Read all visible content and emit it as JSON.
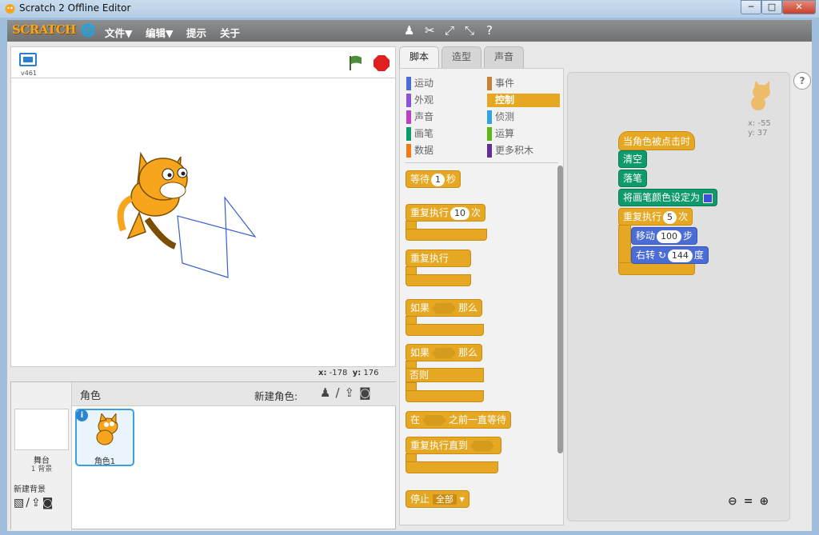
{
  "window": {
    "title": "Scratch 2 Offline Editor",
    "minimize": "─",
    "maximize": "□",
    "close": "✕"
  },
  "menu": {
    "logo": "SCRATCH",
    "file": "文件▼",
    "edit": "编辑▼",
    "tips": "提示",
    "about": "关于"
  },
  "stage": {
    "version": "v461",
    "x_label": "x:",
    "x": "-178",
    "y_label": "y:",
    "y": "176"
  },
  "sprites": {
    "title": "角色",
    "new_sprite": "新建角色:",
    "stage_label": "舞台",
    "stage_bg_count": "1 背景",
    "new_bg": "新建背景",
    "sprite1": "角色1"
  },
  "tabs": [
    "脚本",
    "造型",
    "声音"
  ],
  "categories": {
    "left": [
      "运动",
      "外观",
      "声音",
      "画笔",
      "数据"
    ],
    "right": [
      "事件",
      "控制",
      "侦测",
      "运算",
      "更多积木"
    ]
  },
  "palette": {
    "wait": "等待",
    "wait_num": "1",
    "wait_unit": "秒",
    "repeat": "重复执行",
    "repeat_num": "10",
    "repeat_unit": "次",
    "forever": "重复执行",
    "if": "如果",
    "then": "那么",
    "if2": "如果",
    "then2": "那么",
    "else": "否则",
    "wait_until_pre": "在",
    "wait_until_post": "之前一直等待",
    "repeat_until": "重复执行直到",
    "stop": "停止",
    "stop_opt": "全部"
  },
  "script": {
    "hat": "当角色被点击时",
    "clear": "清空",
    "pendown": "落笔",
    "setcolor": "将画笔颜色设定为",
    "repeat": "重复执行",
    "repeat_num": "5",
    "repeat_unit": "次",
    "move": "移动",
    "move_num": "100",
    "move_unit": "步",
    "turn": "右转",
    "turn_num": "144",
    "turn_unit": "度",
    "sprite_x": "x: -55",
    "sprite_y": "y: 37"
  },
  "colors": {
    "control": "#e6a822",
    "pen": "#0e9a6c",
    "motion": "#4a6cd4",
    "pen_color": "#3a4fd6"
  },
  "icons": [
    "globe-icon",
    "stamp-icon",
    "cut-icon",
    "grow-icon",
    "shrink-icon",
    "help-icon",
    "green-flag-icon",
    "stop-icon",
    "fullscreen-icon"
  ]
}
